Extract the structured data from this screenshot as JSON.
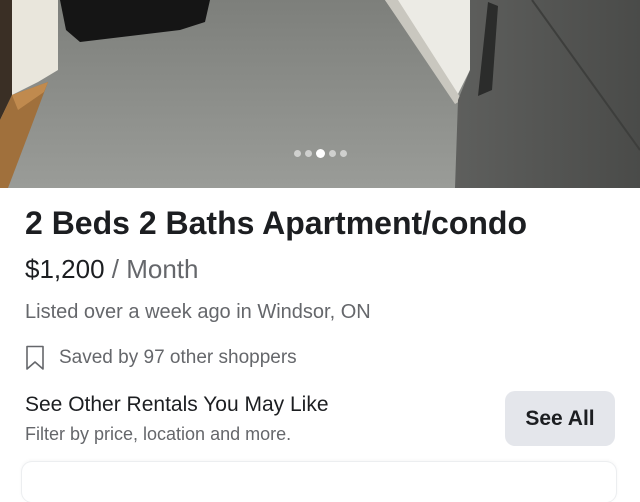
{
  "gallery": {
    "photo_count": 5,
    "active_photo_index": 2
  },
  "listing": {
    "title": "2 Beds 2 Baths Apartment/condo",
    "price": "$1,200",
    "period": " / Month",
    "listed_text": "Listed over a week ago in Windsor, ON",
    "saved_text": "Saved by 97 other shoppers"
  },
  "rentals": {
    "heading": "See Other Rentals You May Like",
    "subtext": "Filter by price, location and more.",
    "button_label": "See All"
  },
  "icons": {
    "saved": "bookmark-icon"
  },
  "colors": {
    "text_primary": "#1c1e21",
    "text_secondary": "#65676b",
    "button_bg": "#e4e6eb"
  }
}
